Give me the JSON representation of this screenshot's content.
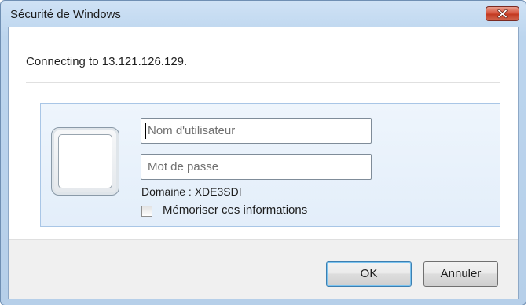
{
  "window": {
    "title": "Sécurité de Windows"
  },
  "message": "Connecting to 13.121.126.129.",
  "credentials": {
    "username_placeholder": "Nom d'utilisateur",
    "password_placeholder": "Mot de passe",
    "domain_label": "Domaine : XDE3SDI",
    "remember_label": "Mémoriser ces informations",
    "remember_checked": false
  },
  "buttons": {
    "ok_label": "OK",
    "cancel_label": "Annuler"
  },
  "icons": {
    "close": "close-icon",
    "user_tile": "user-tile-icon"
  },
  "colors": {
    "titlebar": "#bcd5ee",
    "close_button": "#c33a22",
    "panel_border": "#a9c6e6",
    "panel_background": "#e3eefa",
    "footer": "#f0f0f0"
  }
}
